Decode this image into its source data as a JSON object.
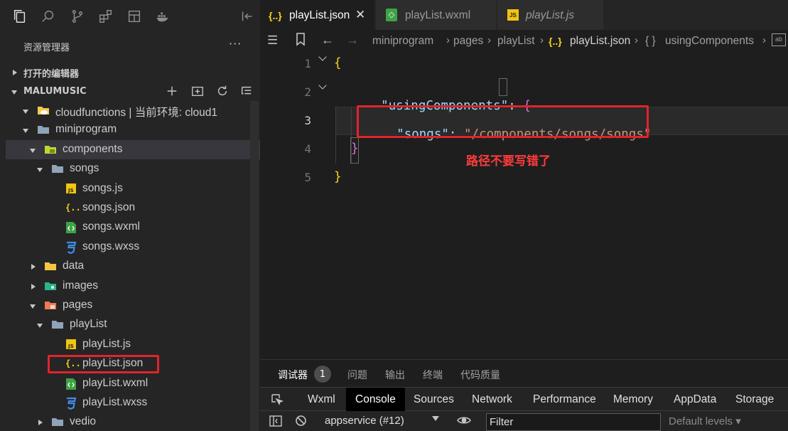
{
  "activity_bar": {
    "icons": [
      "files-icon",
      "search-icon",
      "source-control-icon",
      "extensions-icon",
      "layout-icon",
      "docker-icon"
    ]
  },
  "explorer": {
    "title": "资源管理器",
    "more": "···",
    "open_editors_label": "打开的编辑器",
    "project_label": "MALUMUSIC",
    "tree": [
      {
        "label": "cloudfunctions | 当前环境: cloud1",
        "type": "folder-cloud"
      },
      {
        "label": "miniprogram",
        "type": "folder"
      },
      {
        "label": "components",
        "type": "folder-components"
      },
      {
        "label": "songs",
        "type": "folder"
      },
      {
        "label": "songs.js",
        "type": "js"
      },
      {
        "label": "songs.json",
        "type": "json"
      },
      {
        "label": "songs.wxml",
        "type": "wxml"
      },
      {
        "label": "songs.wxss",
        "type": "wxss"
      },
      {
        "label": "data",
        "type": "folder-data"
      },
      {
        "label": "images",
        "type": "folder-images"
      },
      {
        "label": "pages",
        "type": "folder-pages"
      },
      {
        "label": "playList",
        "type": "folder"
      },
      {
        "label": "playList.js",
        "type": "js"
      },
      {
        "label": "playList.json",
        "type": "json"
      },
      {
        "label": "playList.wxml",
        "type": "wxml"
      },
      {
        "label": "playList.wxss",
        "type": "wxss"
      },
      {
        "label": "vedio",
        "type": "folder"
      }
    ]
  },
  "tabs": [
    {
      "label": "playList.json",
      "icon": "{..}",
      "close": "✕",
      "active": true
    },
    {
      "label": "playList.wxml",
      "icon": "◇",
      "active": false
    },
    {
      "label": "playList.js",
      "icon": "JS",
      "active": false
    }
  ],
  "breadcrumbs": [
    "miniprogram",
    "pages",
    "playList",
    "playList.json",
    "usingComponents"
  ],
  "breadcrumb_icons": {
    "json": "{..}",
    "object": "{ }"
  },
  "editor": {
    "line_numbers": [
      "1",
      "2",
      "3",
      "4",
      "5"
    ],
    "lines": {
      "l1": "{",
      "l2_key": "\"usingComponents\"",
      "l2_colon": ": ",
      "l2_brace": "{",
      "l3_key": "\"songs\"",
      "l3_colon": ": ",
      "l3_value": "\"/components/songs/songs\"",
      "l4": "}",
      "l5": "}"
    },
    "annotation": "路径不要写错了"
  },
  "panel": {
    "tabs": [
      "调试器",
      "问题",
      "输出",
      "终端",
      "代码质量"
    ],
    "badge": "1",
    "devtools_tabs": [
      "Wxml",
      "Console",
      "Sources",
      "Network",
      "Performance",
      "Memory",
      "AppData",
      "Storage"
    ],
    "active_devtools_tab": "Console",
    "context": "appservice (#12)",
    "filter_placeholder": "Filter",
    "levels": "Default levels ▾"
  },
  "colors": {
    "highlight": "#e0242b",
    "annotation": "#ff3b3b",
    "json_key": "#9cdcfe",
    "json_string": "#ce9178",
    "brace": "#f7d21b"
  }
}
